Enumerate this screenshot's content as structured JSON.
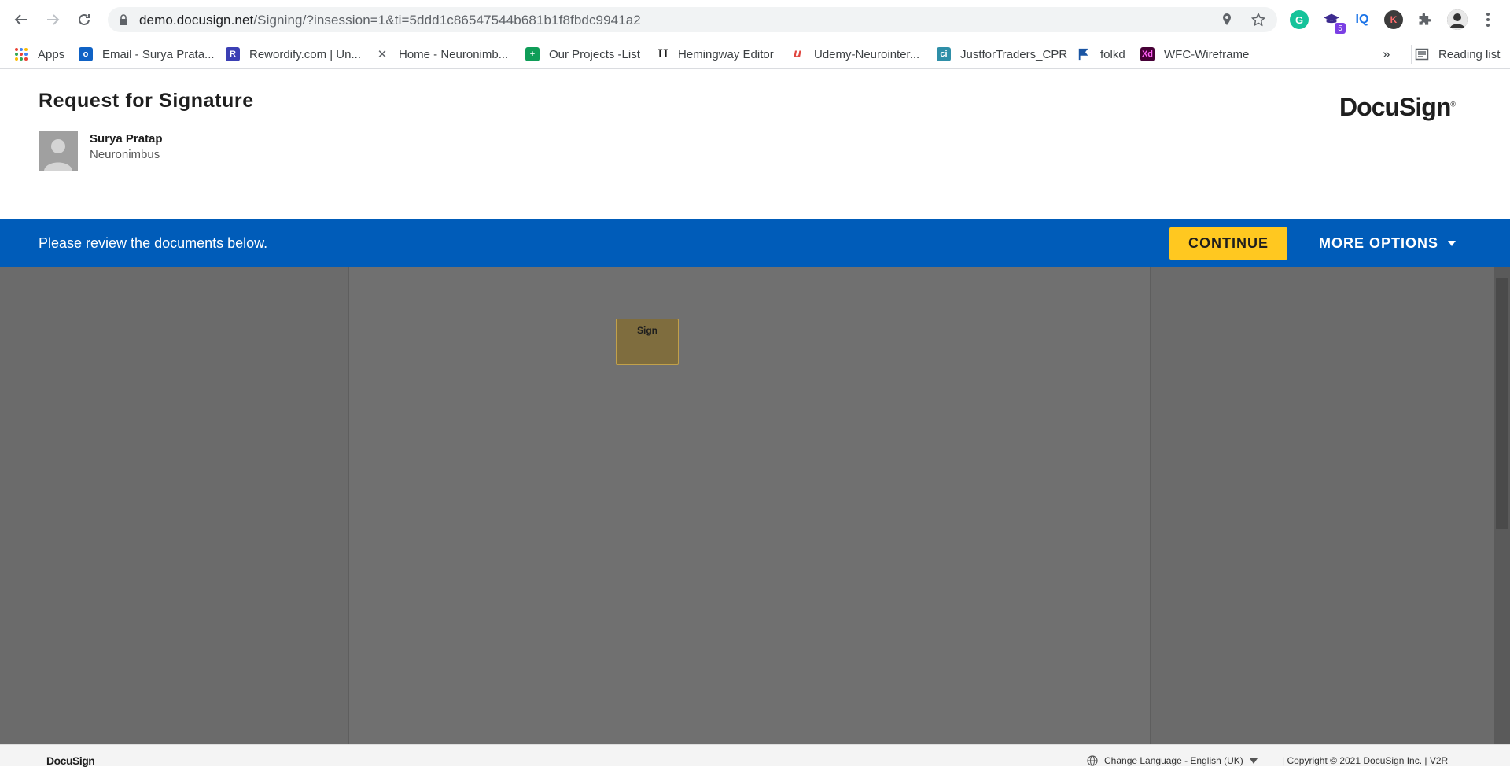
{
  "browser": {
    "url_host": "demo.docusign.net",
    "url_path": "/Signing/?insession=1&ti=5ddd1c86547544b681b1f8fbdc9941a2",
    "extension_badge": "5",
    "extension_iq": "IQ",
    "extension_k": "K",
    "extension_g": "G",
    "bookmarks": [
      {
        "label": "Apps",
        "icon": "apps-grid-icon"
      },
      {
        "label": "Email - Surya Prata...",
        "icon": "outlook-icon"
      },
      {
        "label": "Rewordify.com | Un...",
        "icon": "rewordify-icon"
      },
      {
        "label": "Home - Neuronimb...",
        "icon": "tools-icon"
      },
      {
        "label": "Our Projects -List",
        "icon": "sheets-icon"
      },
      {
        "label": "Hemingway Editor",
        "icon": "hemingway-icon"
      },
      {
        "label": "Udemy-Neurointer...",
        "icon": "udemy-icon"
      },
      {
        "label": "JustforTraders_CPR",
        "icon": "ci-icon"
      },
      {
        "label": "folkd",
        "icon": "folkd-icon"
      },
      {
        "label": "WFC-Wireframe",
        "icon": "xd-icon"
      }
    ],
    "bookmarks_overflow": "»",
    "reading_list": "Reading list"
  },
  "header": {
    "title": "Request for Signature",
    "sender_name": "Surya Pratap",
    "sender_org": "Neuronimbus",
    "logo": "DocuSign"
  },
  "action_bar": {
    "message": "Please review the documents below.",
    "continue_label": "CONTINUE",
    "more_options_label": "MORE OPTIONS"
  },
  "document": {
    "sign_tab_label": "Sign"
  },
  "footer": {
    "logo": "DocuSign",
    "language": "Change Language - English (UK)",
    "copyright": "|   Copyright © 2021 DocuSign Inc.  |  V2R"
  },
  "colors": {
    "action_bar": "#005cb9",
    "continue_button": "#ffc820",
    "viewport_bg": "#6b6b6b",
    "sign_tab": "#7f6d3e"
  }
}
